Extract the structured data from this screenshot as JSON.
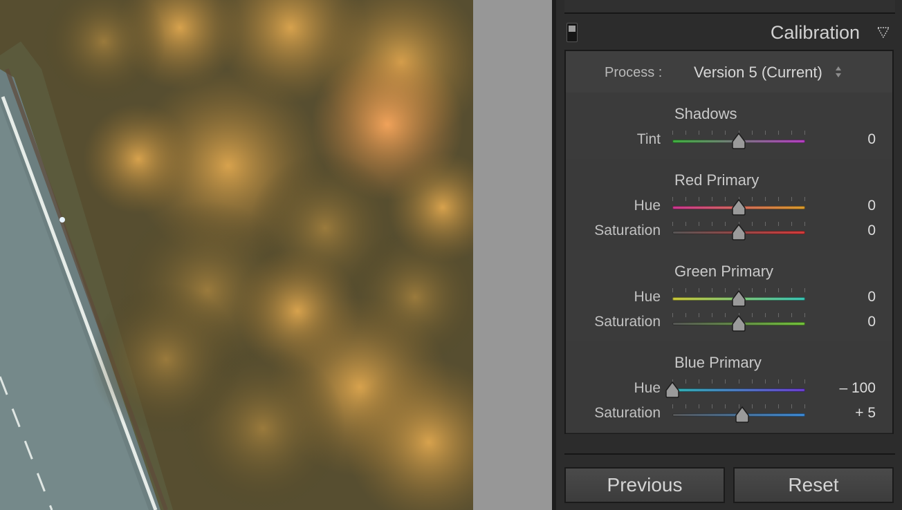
{
  "colors": {
    "panel_bg": "#2c2c2c",
    "section_bg": "#3a3a3a",
    "text": "#d2d2d2",
    "gutter": "#979797"
  },
  "photo": {
    "subject": "aerial-road-and-autumn-trees"
  },
  "panel": {
    "title": "Calibration",
    "toggle_icon": "panel-toggle-switch",
    "collapse_icon": "triangle-down-icon",
    "process": {
      "label": "Process :",
      "value": "Version 5 (Current)",
      "stepper_icon": "up-down-stepper-icon"
    },
    "sections": [
      {
        "title": "Shadows",
        "sliders": [
          {
            "label": "Tint",
            "value": "0",
            "level": 0.5,
            "gradient": [
              "#3fae3f",
              "#b43fc1"
            ]
          }
        ]
      },
      {
        "title": "Red Primary",
        "sliders": [
          {
            "label": "Hue",
            "value": "0",
            "level": 0.5,
            "gradient": [
              "#c9388f",
              "#d89b2c"
            ]
          },
          {
            "label": "Saturation",
            "value": "0",
            "level": 0.5,
            "gradient": [
              "#555555",
              "#d33b3b"
            ]
          }
        ]
      },
      {
        "title": "Green Primary",
        "sliders": [
          {
            "label": "Hue",
            "value": "0",
            "level": 0.5,
            "gradient": [
              "#c9c63a",
              "#39c4b4"
            ]
          },
          {
            "label": "Saturation",
            "value": "0",
            "level": 0.5,
            "gradient": [
              "#555555",
              "#72c23b"
            ]
          }
        ]
      },
      {
        "title": "Blue Primary",
        "sliders": [
          {
            "label": "Hue",
            "value": "– 100",
            "level": 0.0,
            "gradient": [
              "#2fb3b3",
              "#6b3fcf"
            ]
          },
          {
            "label": "Saturation",
            "value": "+ 5",
            "level": 0.525,
            "gradient": [
              "#555555",
              "#3c88d3"
            ]
          }
        ]
      }
    ]
  },
  "buttons": {
    "previous": "Previous",
    "reset": "Reset"
  }
}
